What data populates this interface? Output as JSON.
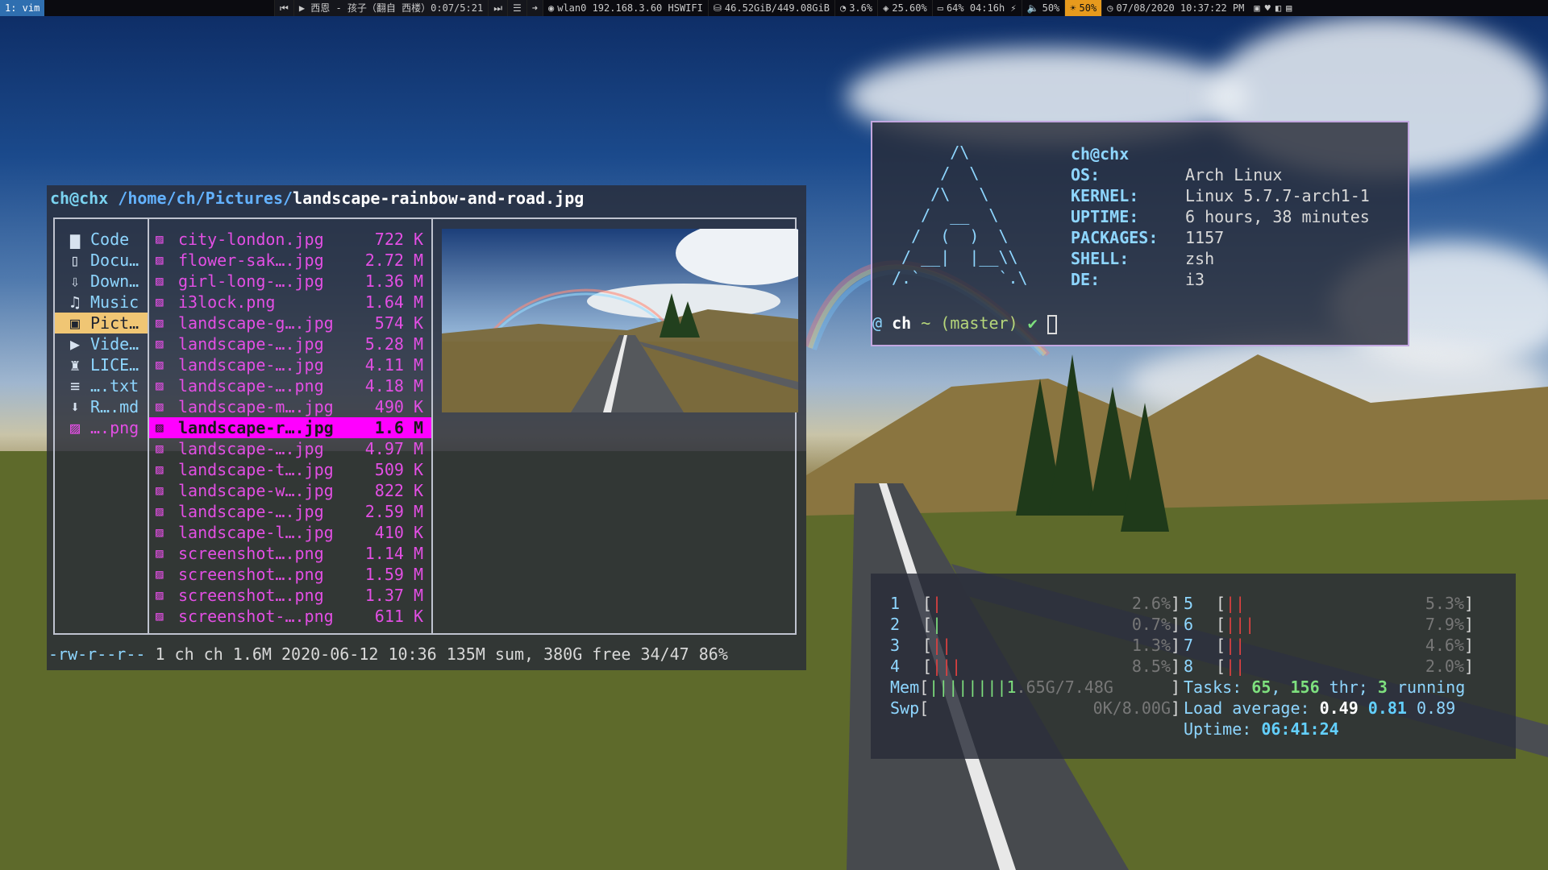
{
  "topbar": {
    "workspace": "1: vim",
    "media_prev_icon": "skip-back-icon",
    "media": "▶ 西恩 - 孩子（翻自 西楼）0:07/5:21",
    "media_next_icon": "skip-forward-icon",
    "list_icon": "list-icon",
    "arrow_icon": "arrow-right-icon",
    "wifi": "wlan0 192.168.3.60 HSWIFI",
    "disk": "46.52GiB/449.08GiB",
    "cpu": "3.6%",
    "mem": "25.60%",
    "battery": "64% 04:16h ⚡",
    "volume": "50%",
    "brightness": "50%",
    "datetime": "07/08/2020 10:37:22 PM"
  },
  "ranger": {
    "title_host": "ch@chx ",
    "title_path": "/home/ch/Pictures/",
    "title_file": "landscape-rainbow-and-road.jpg",
    "dirs": [
      {
        "icon": "folder-icon",
        "label": "Code"
      },
      {
        "icon": "documents-icon",
        "label": "Docu…"
      },
      {
        "icon": "download-icon",
        "label": "Down…"
      },
      {
        "icon": "music-icon",
        "label": "Music"
      },
      {
        "icon": "pictures-icon",
        "label": "Pict…"
      },
      {
        "icon": "video-icon",
        "label": "Vide…"
      },
      {
        "icon": "license-icon",
        "label": "LICE…"
      },
      {
        "icon": "text-icon",
        "label": "….txt"
      },
      {
        "icon": "markdown-icon",
        "label": "R….md"
      },
      {
        "icon": "image-icon",
        "label": "….png"
      }
    ],
    "files": [
      {
        "name": "city-london.jpg",
        "size": "722 K"
      },
      {
        "name": "flower-sak….jpg",
        "size": "2.72 M"
      },
      {
        "name": "girl-long-….jpg",
        "size": "1.36 M"
      },
      {
        "name": "i3lock.png",
        "size": "1.64 M"
      },
      {
        "name": "landscape-g….jpg",
        "size": "574 K"
      },
      {
        "name": "landscape-….jpg",
        "size": "5.28 M"
      },
      {
        "name": "landscape-….jpg",
        "size": "4.11 M"
      },
      {
        "name": "landscape-….png",
        "size": "4.18 M"
      },
      {
        "name": "landscape-m….jpg",
        "size": "490 K"
      },
      {
        "name": "landscape-r….jpg",
        "size": "1.6 M"
      },
      {
        "name": "landscape-….jpg",
        "size": "4.97 M"
      },
      {
        "name": "landscape-t….jpg",
        "size": "509 K"
      },
      {
        "name": "landscape-w….jpg",
        "size": "822 K"
      },
      {
        "name": "landscape-….jpg",
        "size": "2.59 M"
      },
      {
        "name": "landscape-l….jpg",
        "size": "410 K"
      },
      {
        "name": "screenshot….png",
        "size": "1.14 M"
      },
      {
        "name": "screenshot….png",
        "size": "1.59 M"
      },
      {
        "name": "screenshot….png",
        "size": "1.37 M"
      },
      {
        "name": "screenshot-….png",
        "size": "611 K"
      }
    ],
    "status_perm": "-rw-r--r--",
    "status_rest": " 1 ch ch 1.6M 2020-06-12 10:36 135M sum, 380G free  34/47  86%"
  },
  "neofetch": {
    "logo": "      /\\\n     /  \\\n    /\\   \\\n   /  __  \\\n  /  (  )  \\\n / __|  |__\\\\\n/.`        `.\\",
    "user": "ch@chx",
    "rows": [
      {
        "k": "OS:",
        "v": "Arch Linux"
      },
      {
        "k": "KERNEL:",
        "v": "Linux 5.7.7-arch1-1"
      },
      {
        "k": "UPTIME:",
        "v": "6 hours, 38 minutes"
      },
      {
        "k": "PACKAGES:",
        "v": "1157"
      },
      {
        "k": "SHELL:",
        "v": "zsh"
      },
      {
        "k": "DE:",
        "v": "i3"
      }
    ],
    "prompt_at": "@ ",
    "prompt_user": "ch",
    "prompt_git": " ~ (master) ",
    "prompt_check": "✔"
  },
  "htop": {
    "cpus_left": [
      {
        "n": "1",
        "bars": "|",
        "pct": "2.6%"
      },
      {
        "n": "2",
        "bars": "|",
        "pct": "0.7%"
      },
      {
        "n": "3",
        "bars": "||",
        "pct": "1.3%"
      },
      {
        "n": "4",
        "bars": "|||",
        "pct": "8.5%"
      }
    ],
    "cpus_right": [
      {
        "n": "5",
        "bars": "||",
        "pct": "5.3%"
      },
      {
        "n": "6",
        "bars": "|||",
        "pct": "7.9%"
      },
      {
        "n": "7",
        "bars": "||",
        "pct": "4.6%"
      },
      {
        "n": "8",
        "bars": "||",
        "pct": "2.0%"
      }
    ],
    "mem_label": "Mem",
    "mem_bars": "||||||||1",
    "mem_value": ".65G/7.48G",
    "swp_label": "Swp",
    "swp_value": "0K/8.00G",
    "tasks_label": "Tasks: ",
    "tasks": "65",
    "thr": "156",
    "thr_label": " thr; ",
    "running": "3",
    "running_label": " running",
    "load_label": "Load average: ",
    "load1": "0.49",
    "load5": "0.81",
    "load15": "0.89",
    "uptime_label": "Uptime: ",
    "uptime": "06:41:24"
  }
}
